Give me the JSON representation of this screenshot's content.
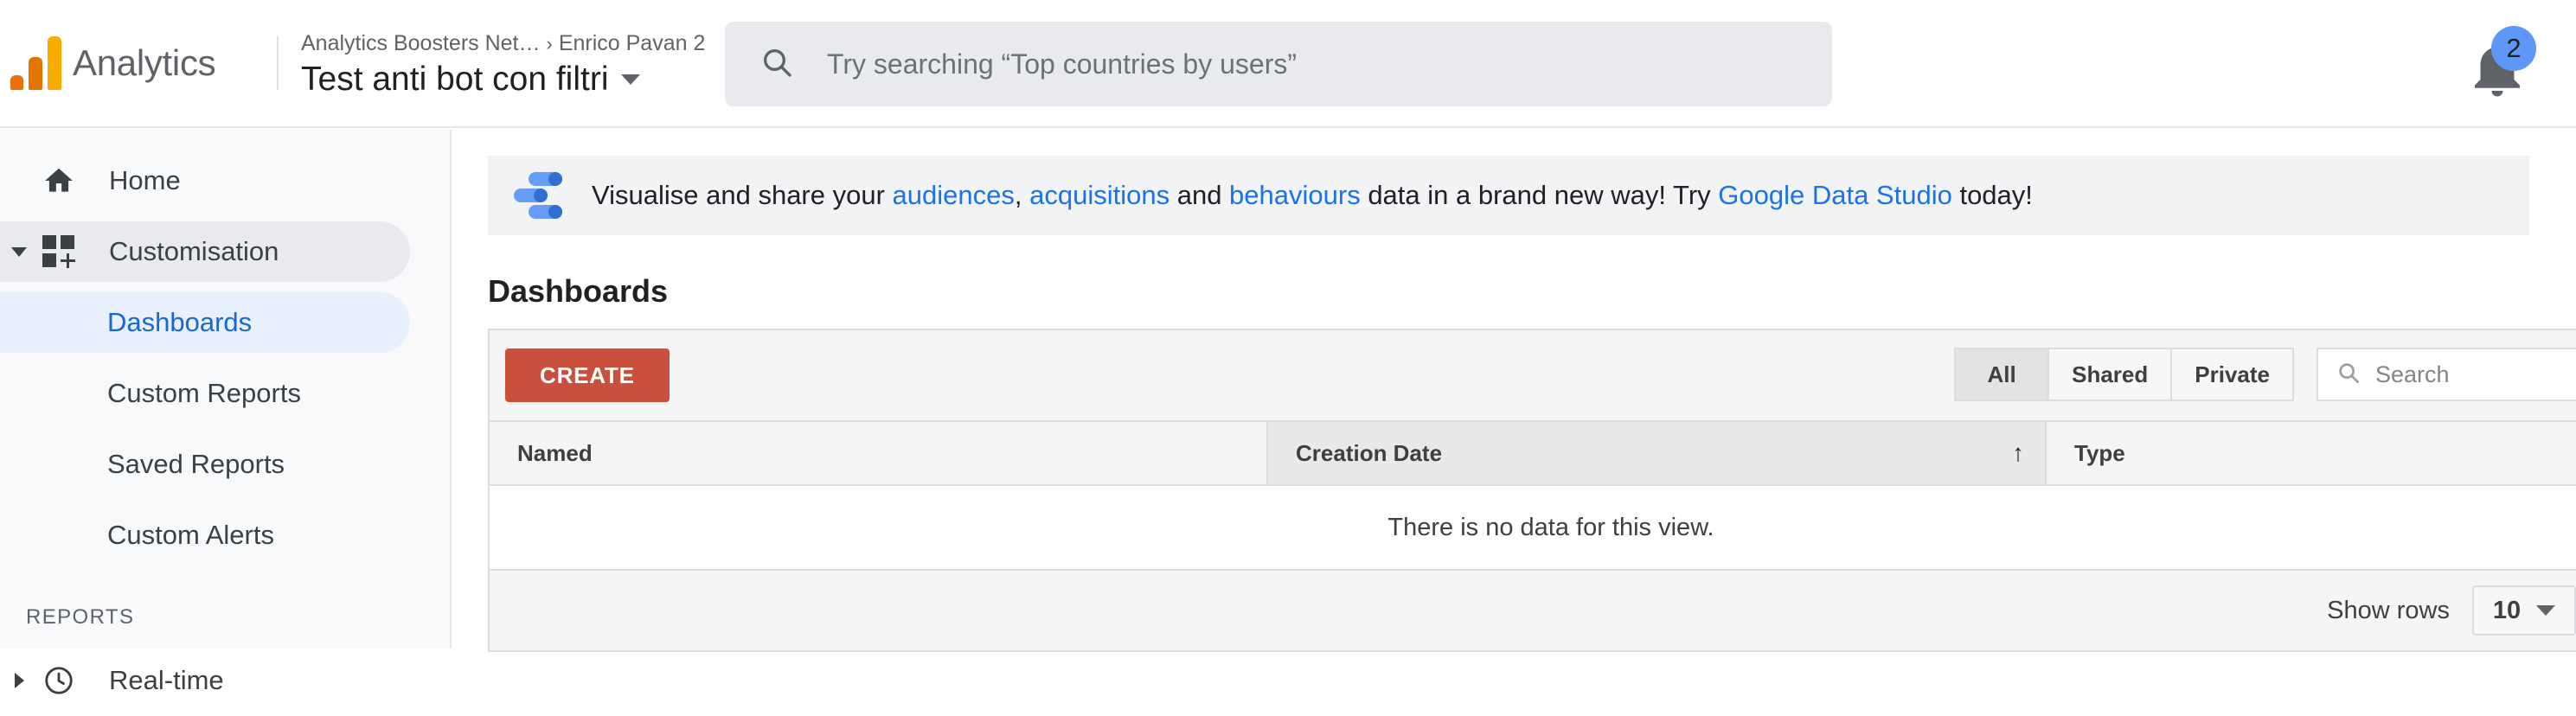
{
  "topbar": {
    "brand": "Analytics",
    "logo_colors": {
      "bar1": "#E8710A",
      "bar2": "#E37400",
      "bar3": "#F9AB00"
    },
    "breadcrumb_account": "Analytics Boosters Net…",
    "breadcrumb_separator": "›",
    "breadcrumb_property": "Enrico Pavan 2",
    "view_name": "Test anti bot con filtri",
    "search_placeholder": "Try searching “Top countries by users”",
    "search_value": "",
    "notification_count": "2",
    "notification_badge_color": "#5E97F6"
  },
  "sidebar": {
    "items": [
      {
        "label": "Home",
        "icon": "home-icon",
        "state": "default"
      },
      {
        "label": "Customisation",
        "icon": "grid-plus-icon",
        "state": "selected-grey",
        "expanded": true
      }
    ],
    "sub_items": [
      {
        "label": "Dashboards",
        "state": "selected-blue"
      },
      {
        "label": "Custom Reports",
        "state": "default"
      },
      {
        "label": "Saved Reports",
        "state": "default"
      },
      {
        "label": "Custom Alerts",
        "state": "default"
      }
    ],
    "section_label": "REPORTS",
    "reports_items": [
      {
        "label": "Real-time",
        "icon": "clock-icon",
        "state": "default"
      }
    ],
    "active_color": "#1967d2"
  },
  "banner": {
    "icon": "data-studio-icon",
    "text_1": "Visualise and share your ",
    "link_1": "audiences",
    "text_2": ", ",
    "link_2": "acquisitions",
    "text_3": " and ",
    "link_3": "behaviours",
    "text_4": " data in a brand new way! Try ",
    "link_4": "Google Data Studio",
    "text_5": " today!",
    "link_color": "#1a73e8"
  },
  "page": {
    "title": "Dashboards"
  },
  "toolbar": {
    "create_label": "CREATE",
    "create_color": "#c9503c",
    "segments": [
      {
        "label": "All",
        "active": true
      },
      {
        "label": "Shared",
        "active": false
      },
      {
        "label": "Private",
        "active": false
      }
    ],
    "filter_placeholder": "Search",
    "filter_value": ""
  },
  "table": {
    "columns": [
      {
        "label": "Named",
        "sorted": false,
        "sort_arrow": ""
      },
      {
        "label": "Creation Date",
        "sorted": true,
        "sort_arrow": "↑"
      },
      {
        "label": "Type",
        "sorted": false,
        "sort_arrow": ""
      }
    ],
    "empty_message": "There is no data for this view.",
    "rows": []
  },
  "footer": {
    "show_rows_label": "Show rows",
    "rows_value": "10"
  }
}
